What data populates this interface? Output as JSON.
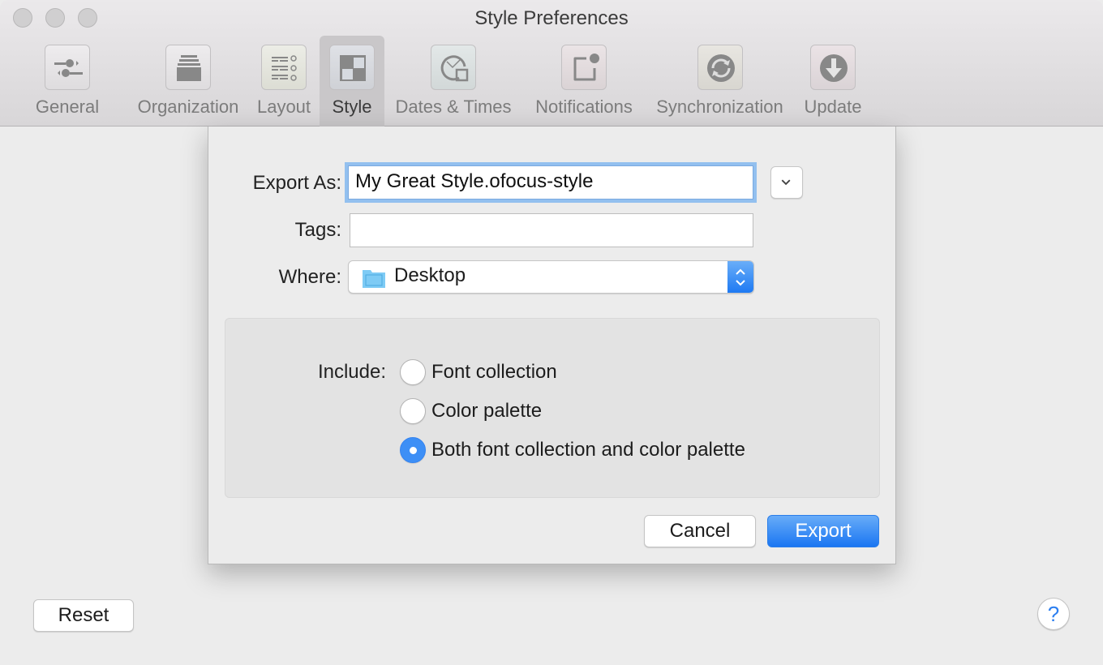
{
  "window": {
    "title": "Style Preferences",
    "traffic_lights": [
      "close",
      "minimize",
      "zoom"
    ]
  },
  "toolbar": {
    "items": [
      {
        "label": "General",
        "icon": "sliders-icon",
        "selected": false
      },
      {
        "label": "Organization",
        "icon": "stack-icon",
        "selected": false
      },
      {
        "label": "Layout",
        "icon": "list-layout-icon",
        "selected": false
      },
      {
        "label": "Style",
        "icon": "checker-style-icon",
        "selected": true
      },
      {
        "label": "Dates & Times",
        "icon": "clock-calendar-icon",
        "selected": false
      },
      {
        "label": "Notifications",
        "icon": "notification-badge-icon",
        "selected": false
      },
      {
        "label": "Synchronization",
        "icon": "sync-icon",
        "selected": false
      },
      {
        "label": "Update",
        "icon": "download-arrow-icon",
        "selected": false
      }
    ]
  },
  "export_sheet": {
    "export_as_label": "Export As:",
    "export_as_value": "My Great Style.ofocus-style",
    "tags_label": "Tags:",
    "tags_value": "",
    "where_label": "Where:",
    "where_value": "Desktop",
    "include_label": "Include:",
    "include_options": [
      {
        "label": "Font collection",
        "selected": false
      },
      {
        "label": "Color palette",
        "selected": false
      },
      {
        "label": "Both font collection and color palette",
        "selected": true
      }
    ],
    "cancel_label": "Cancel",
    "export_label": "Export"
  },
  "footer": {
    "reset_label": "Reset",
    "help_label": "?"
  },
  "colors": {
    "accent": "#1a76f2",
    "focus_ring": "#93c0ef",
    "folder": "#7ecbf5"
  }
}
